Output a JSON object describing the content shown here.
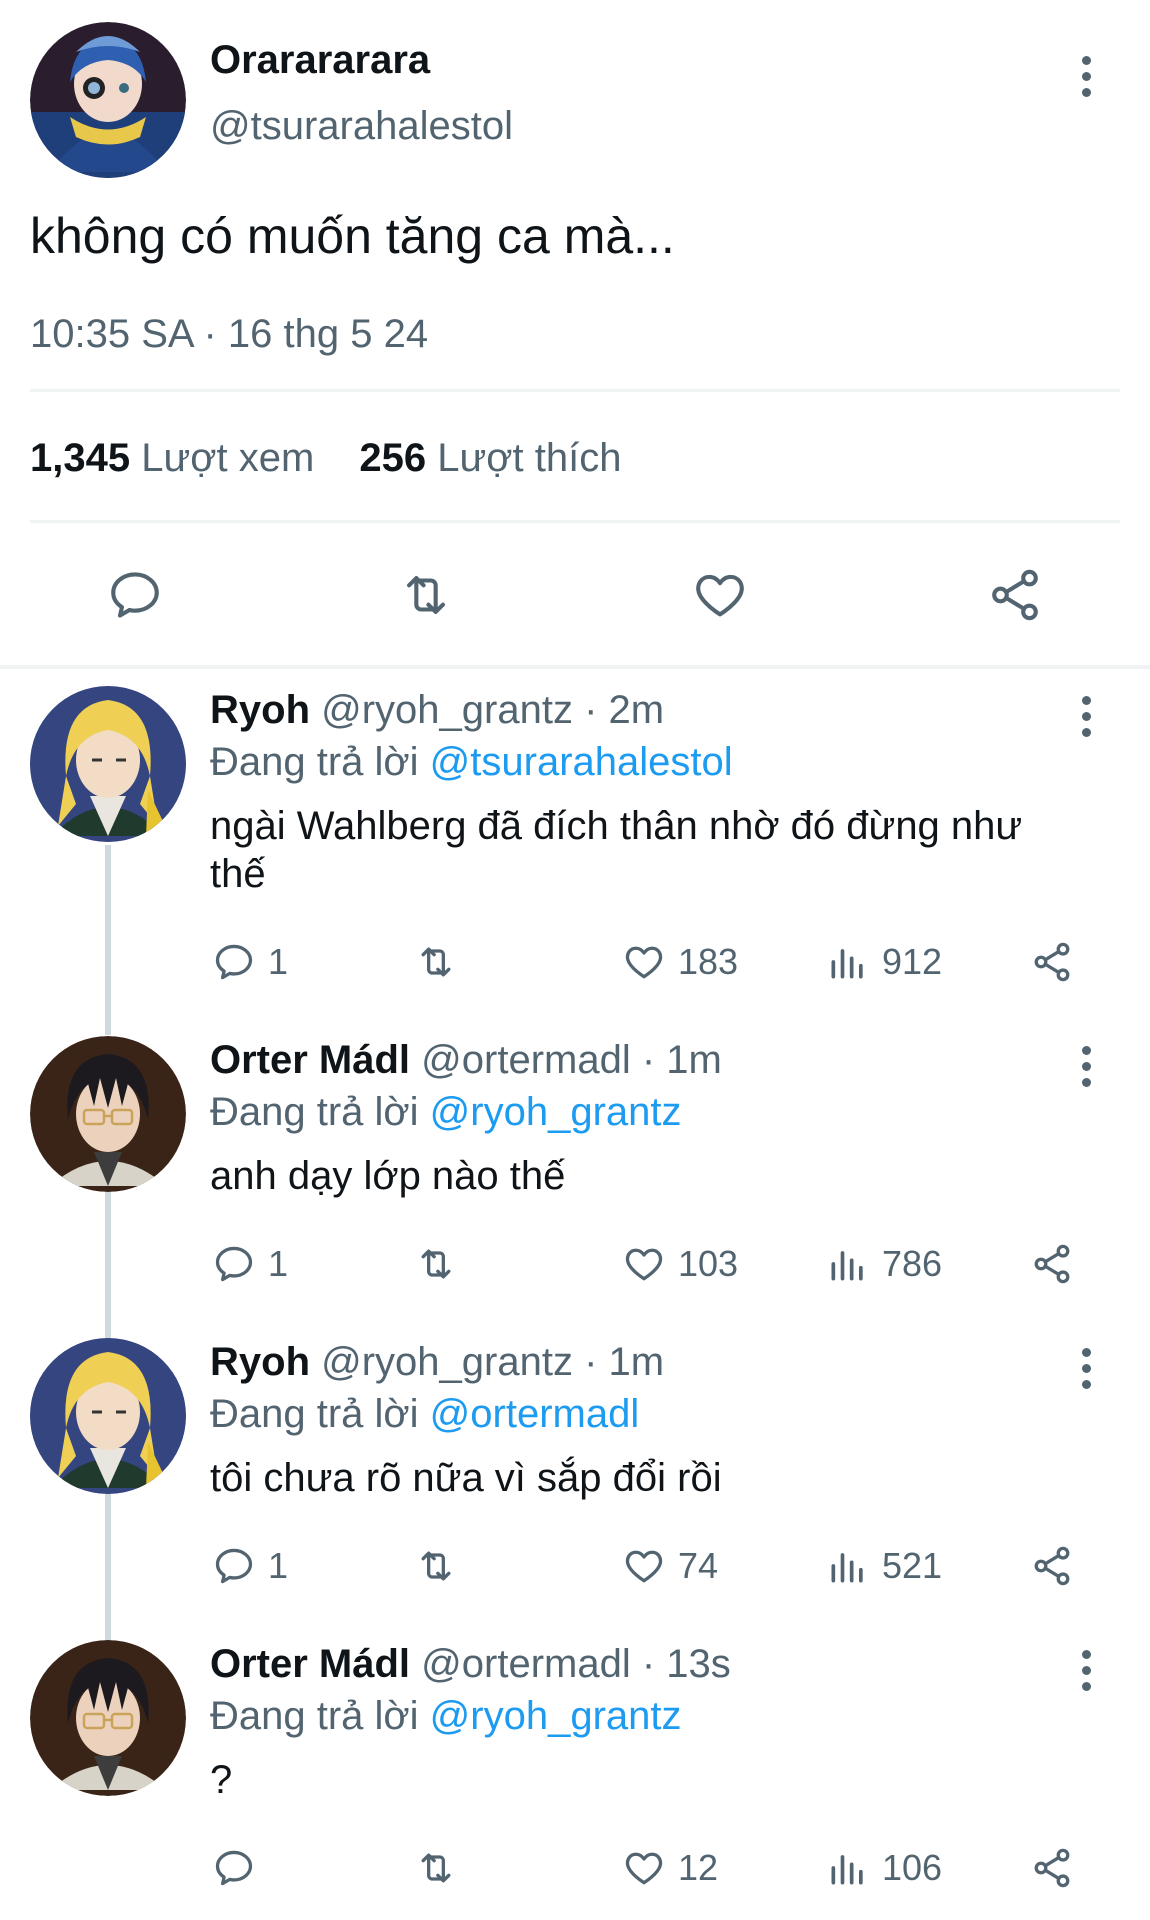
{
  "main_tweet": {
    "display_name": "Orarararara",
    "handle": "@tsurarahalestol",
    "text": "không có muốn tăng ca mà...",
    "timestamp": "10:35 SA · 16 thg 5 24",
    "views_count": "1,345",
    "views_label": "Lượt xem",
    "likes_count": "256",
    "likes_label": "Lượt thích"
  },
  "replying_label": "Đang trả lời",
  "replies": [
    {
      "name": "Ryoh",
      "handle": "@ryoh_grantz",
      "time": "· 2m",
      "reply_to": "@tsurarahalestol",
      "text": "ngài Wahlberg đã đích thân nhờ đó đừng như thế",
      "replies": "1",
      "likes": "183",
      "views": "912"
    },
    {
      "name": "Orter Mádl",
      "handle": "@ortermadl",
      "time": "· 1m",
      "reply_to": "@ryoh_grantz",
      "text": "anh dạy lớp nào thế",
      "replies": "1",
      "likes": "103",
      "views": "786"
    },
    {
      "name": "Ryoh",
      "handle": "@ryoh_grantz",
      "time": "· 1m",
      "reply_to": "@ortermadl",
      "text": "tôi chưa rõ nữa vì sắp đổi rồi",
      "replies": "1",
      "likes": "74",
      "views": "521"
    },
    {
      "name": "Orter Mádl",
      "handle": "@ortermadl",
      "time": "· 13s",
      "reply_to": "@ryoh_grantz",
      "text": "?",
      "replies": "",
      "likes": "12",
      "views": "106"
    }
  ],
  "icons": {
    "reply": "speech-bubble-icon",
    "retweet": "retweet-icon",
    "like": "heart-icon",
    "views": "bar-chart-icon",
    "share": "share-icon",
    "more": "vertical-dots-icon"
  },
  "colors": {
    "text": "#0f1419",
    "muted": "#536471",
    "link": "#1d9bf0",
    "divider": "#eff3f4"
  }
}
